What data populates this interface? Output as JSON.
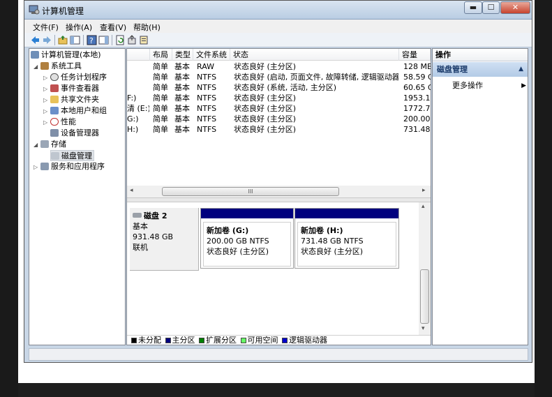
{
  "window": {
    "title": "计算机管理",
    "min_glyph": "▬",
    "max_glyph": "☐",
    "close_glyph": "✕"
  },
  "menu": [
    "文件(F)",
    "操作(A)",
    "查看(V)",
    "帮助(H)"
  ],
  "tree": {
    "root": "计算机管理(本地)",
    "system_tools": "系统工具",
    "task_scheduler": "任务计划程序",
    "event_viewer": "事件查看器",
    "shared_folders": "共享文件夹",
    "local_users": "本地用户和组",
    "performance": "性能",
    "device_manager": "设备管理器",
    "storage": "存储",
    "disk_management": "磁盘管理",
    "services_apps": "服务和应用程序"
  },
  "volumes": {
    "columns": [
      "布局",
      "类型",
      "文件系统",
      "状态",
      "容量"
    ],
    "rows": [
      {
        "name": "",
        "layout": "简单",
        "type": "基本",
        "fs": "RAW",
        "status": "状态良好 (主分区)",
        "capacity": "128 MB"
      },
      {
        "name": "",
        "layout": "简单",
        "type": "基本",
        "fs": "NTFS",
        "status": "状态良好 (启动, 页面文件, 故障转储, 逻辑驱动器)",
        "capacity": "58.59 G"
      },
      {
        "name": "",
        "layout": "简单",
        "type": "基本",
        "fs": "NTFS",
        "status": "状态良好 (系统, 活动, 主分区)",
        "capacity": "60.65 G"
      },
      {
        "name": "F:)",
        "layout": "简单",
        "type": "基本",
        "fs": "NTFS",
        "status": "状态良好 (主分区)",
        "capacity": "1953.1"
      },
      {
        "name": "清 (E:)",
        "layout": "简单",
        "type": "基本",
        "fs": "NTFS",
        "status": "状态良好 (主分区)",
        "capacity": "1772.7"
      },
      {
        "name": "G:)",
        "layout": "简单",
        "type": "基本",
        "fs": "NTFS",
        "status": "状态良好 (主分区)",
        "capacity": "200.00"
      },
      {
        "name": "H:)",
        "layout": "简单",
        "type": "基本",
        "fs": "NTFS",
        "status": "状态良好 (主分区)",
        "capacity": "731.48"
      }
    ],
    "scroll_grip": "III"
  },
  "disk": {
    "name": "磁盘 2",
    "type": "基本",
    "size": "931.48 GB",
    "state": "联机",
    "partitions": [
      {
        "title": "新加卷 (G:)",
        "size": "200.00 GB NTFS",
        "status": "状态良好 (主分区)"
      },
      {
        "title": "新加卷 (H:)",
        "size": "731.48 GB NTFS",
        "status": "状态良好 (主分区)"
      }
    ]
  },
  "legend": [
    {
      "label": "未分配",
      "color": "#000000"
    },
    {
      "label": "主分区",
      "color": "#00007e"
    },
    {
      "label": "扩展分区",
      "color": "#008000"
    },
    {
      "label": "可用空间",
      "color": "#66ff66"
    },
    {
      "label": "逻辑驱动器",
      "color": "#0000cc"
    }
  ],
  "actions": {
    "header": "操作",
    "group": "磁盘管理",
    "more": "更多操作"
  }
}
